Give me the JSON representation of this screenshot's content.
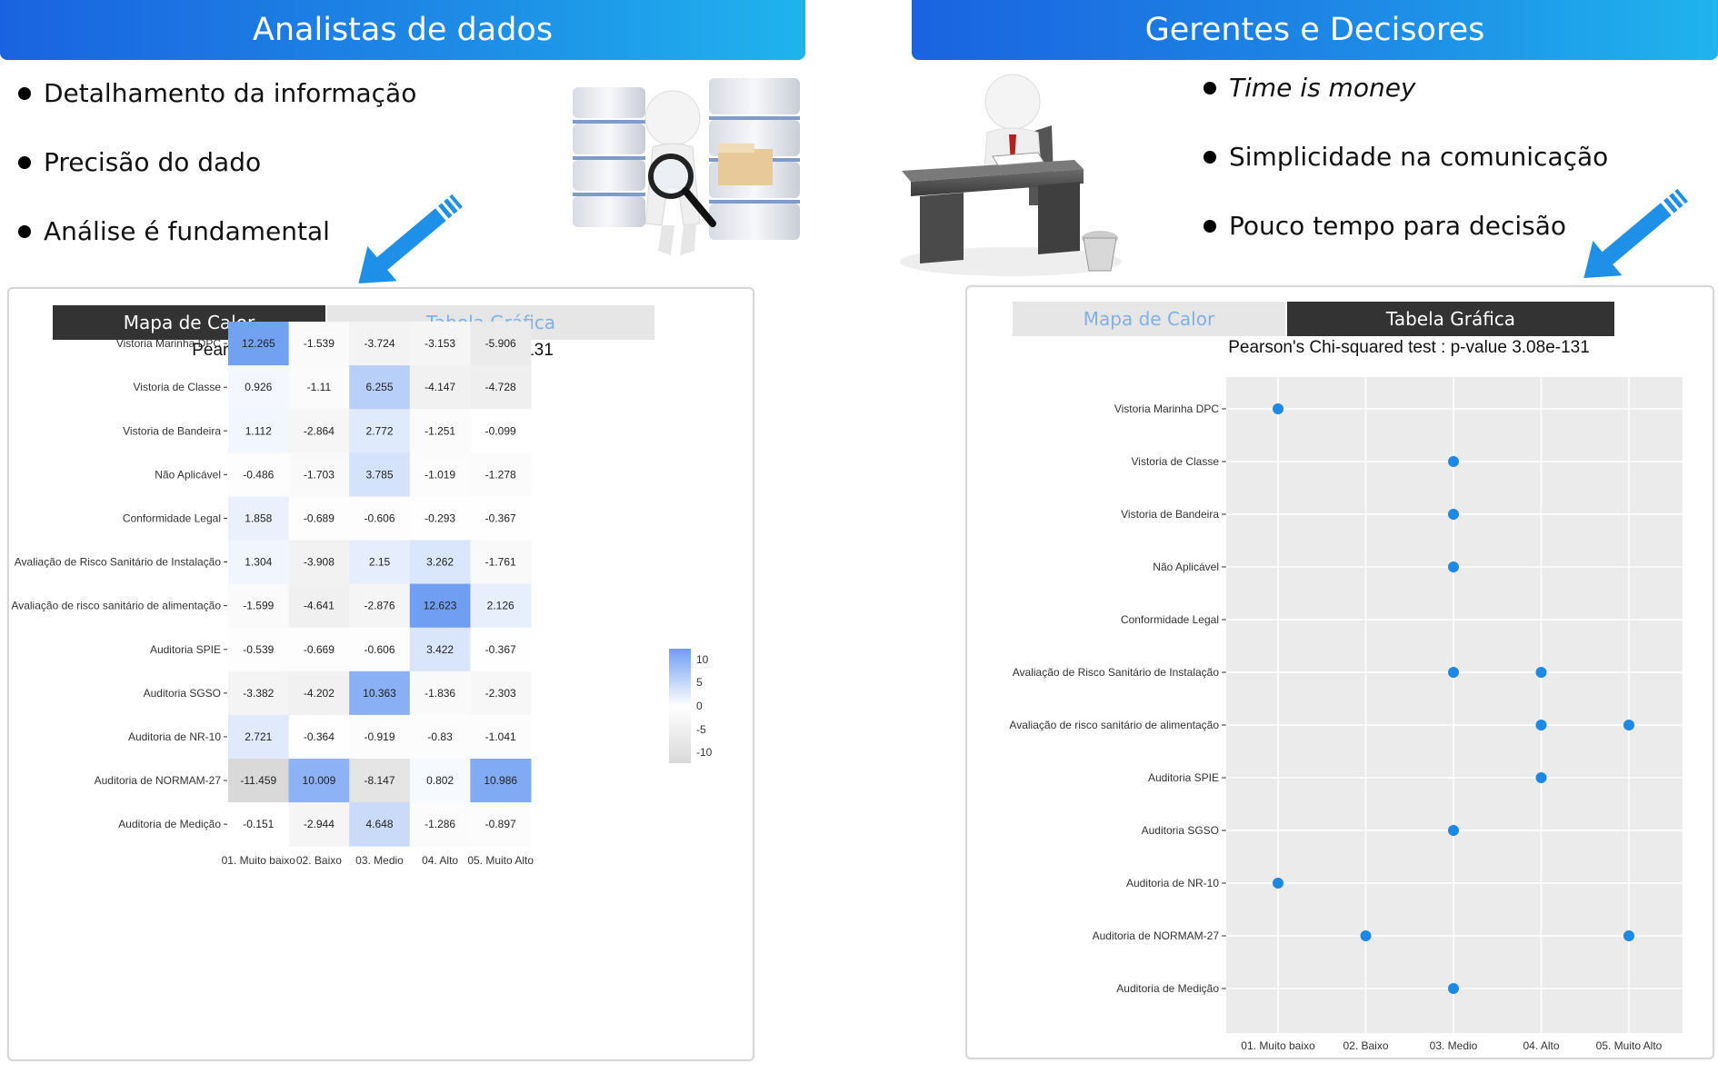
{
  "left": {
    "banner": "Analistas de dados",
    "bullets": [
      "Detalhamento da informação",
      "Precisão do dado",
      "Análise é fundamental"
    ],
    "tabs": {
      "heatmap": "Mapa de Calor",
      "table": "Tabela Gráfica",
      "active": "heatmap"
    }
  },
  "right": {
    "banner": "Gerentes e Decisores",
    "bullets": [
      "Time is money",
      "Simplicidade na comunicação",
      "Pouco tempo para decisão"
    ],
    "tabs": {
      "heatmap": "Mapa de Calor",
      "table": "Tabela Gráfica",
      "active": "table"
    }
  },
  "colors": {
    "banner_start": "#1a63e0",
    "banner_end": "#1fb4ee",
    "point": "#1e88e5",
    "heat_high": "#6f9ef2",
    "heat_low": "#d9d9d9",
    "arrow": "#1e90e8"
  },
  "icons": [
    "arrow-icon",
    "database-magnifier-icon",
    "desk-manager-icon"
  ],
  "chart_data": [
    {
      "type": "heatmap",
      "title": "Pearson's Chi-squared test : p-value  3.08e-131",
      "x": [
        "01. Muito baixo",
        "02. Baixo",
        "03. Medio",
        "04. Alto",
        "05. Muito Alto"
      ],
      "y": [
        "Vistoria Marinha DPC",
        "Vistoria de Classe",
        "Vistoria de Bandeira",
        "Não Aplicável",
        "Conformidade Legal",
        "Avaliação de Risco Sanitário de Instalação",
        "Avaliação de risco sanitário de alimentação",
        "Auditoria SPIE",
        "Auditoria SGSO",
        "Auditoria de NR-10",
        "Auditoria de NORMAM-27",
        "Auditoria de Medição"
      ],
      "values": [
        [
          "12.265",
          "-1.539",
          "-3.724",
          "-3.153",
          "-5.906"
        ],
        [
          "0.926",
          "-1.11",
          "6.255",
          "-4.147",
          "-4.728"
        ],
        [
          "1.112",
          "-2.864",
          "2.772",
          "-1.251",
          "-0.099"
        ],
        [
          "-0.486",
          "-1.703",
          "3.785",
          "-1.019",
          "-1.278"
        ],
        [
          "1.858",
          "-0.689",
          "-0.606",
          "-0.293",
          "-0.367"
        ],
        [
          "1.304",
          "-3.908",
          "2.15",
          "3.262",
          "-1.761"
        ],
        [
          "-1.599",
          "-4.641",
          "-2.876",
          "12.623",
          "2.126"
        ],
        [
          "-0.539",
          "-0.669",
          "-0.606",
          "3.422",
          "-0.367"
        ],
        [
          "-3.382",
          "-4.202",
          "10.363",
          "-1.836",
          "-2.303"
        ],
        [
          "2.721",
          "-0.364",
          "-0.919",
          "-0.83",
          "-1.041"
        ],
        [
          "-11.459",
          "10.009",
          "-8.147",
          "0.802",
          "10.986"
        ],
        [
          "-0.151",
          "-2.944",
          "4.648",
          "-1.286",
          "-0.897"
        ]
      ],
      "legend": {
        "ticks": [
          "10",
          "5",
          "0",
          "-5",
          "-10"
        ],
        "range": [
          -10,
          12.6
        ],
        "placement": "right"
      }
    },
    {
      "type": "scatter",
      "title": "Pearson's Chi-squared test : p-value  3.08e-131",
      "x": [
        "01. Muito baixo",
        "02. Baixo",
        "03. Medio",
        "04. Alto",
        "05. Muito Alto"
      ],
      "y": [
        "Vistoria Marinha DPC",
        "Vistoria de Classe",
        "Vistoria de Bandeira",
        "Não Aplicável",
        "Conformidade Legal",
        "Avaliação de Risco Sanitário de Instalação",
        "Avaliação de risco sanitário de alimentação",
        "Auditoria SPIE",
        "Auditoria SGSO",
        "Auditoria de NR-10",
        "Auditoria de NORMAM-27",
        "Auditoria de Medição"
      ],
      "points": [
        [
          "Vistoria Marinha DPC",
          "01. Muito baixo"
        ],
        [
          "Vistoria de Classe",
          "03. Medio"
        ],
        [
          "Vistoria de Bandeira",
          "03. Medio"
        ],
        [
          "Não Aplicável",
          "03. Medio"
        ],
        [
          "Avaliação de Risco Sanitário de Instalação",
          "03. Medio"
        ],
        [
          "Avaliação de Risco Sanitário de Instalação",
          "04. Alto"
        ],
        [
          "Avaliação de risco sanitário de alimentação",
          "04. Alto"
        ],
        [
          "Avaliação de risco sanitário de alimentação",
          "05. Muito Alto"
        ],
        [
          "Auditoria SPIE",
          "04. Alto"
        ],
        [
          "Auditoria SGSO",
          "03. Medio"
        ],
        [
          "Auditoria de NR-10",
          "01. Muito baixo"
        ],
        [
          "Auditoria de NORMAM-27",
          "02. Baixo"
        ],
        [
          "Auditoria de NORMAM-27",
          "05. Muito Alto"
        ],
        [
          "Auditoria de Medição",
          "03. Medio"
        ]
      ],
      "grid": true
    }
  ]
}
